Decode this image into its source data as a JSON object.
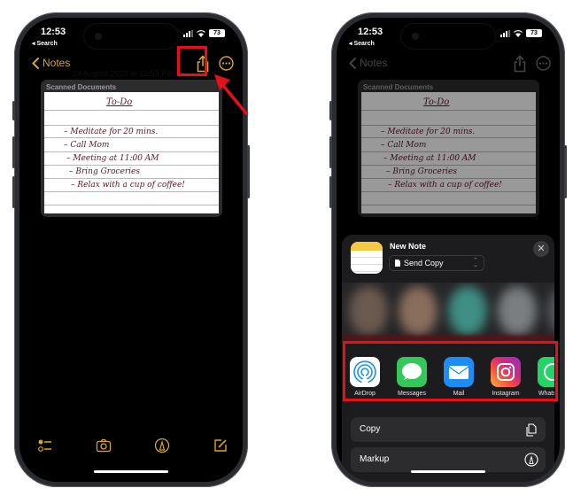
{
  "colors": {
    "accent": "#d9a52a",
    "highlight": "#e4101a",
    "screen_bg": "#000000",
    "sheet_bg": "#1c1c1e"
  },
  "left_phone": {
    "status": {
      "time": "12:53",
      "back_label": "◂ Search",
      "battery": "73"
    },
    "nav": {
      "back_label": "Notes",
      "back_icon": "chevron-left-icon",
      "share_icon": "share-icon",
      "more_icon": "ellipsis-circle-icon",
      "date": "24 August 2023 at 12:53 PM"
    },
    "document": {
      "section_title": "Scanned Documents",
      "handwriting_title": "To-Do",
      "handwriting_lines": [
        "– Meditate for 20 mins.",
        "– Call Mom",
        "– Meeting at 11:00 AM",
        "– Bring Groceries",
        "– Relax with a cup of coffee!"
      ]
    },
    "toolbar": [
      {
        "icon": "checklist-icon"
      },
      {
        "icon": "camera-icon"
      },
      {
        "icon": "markup-pen-icon"
      },
      {
        "icon": "compose-icon"
      }
    ]
  },
  "right_phone": {
    "status": {
      "time": "12:53",
      "back_label": "◂ Search",
      "battery": "73"
    },
    "nav": {
      "back_label": "Notes"
    },
    "document": {
      "section_title": "Scanned Documents",
      "handwriting_title": "To-Do",
      "handwriting_lines": [
        "– Meditate for 20 mins.",
        "– Call Mom",
        "– Meeting at 11:00 AM",
        "– Bring Groceries",
        "– Relax with a cup of coffee!"
      ]
    },
    "share_sheet": {
      "title": "New Note",
      "mode_selector": "Send Copy",
      "close_icon": "close-icon",
      "apps": [
        {
          "label": "AirDrop",
          "icon": "airdrop-icon",
          "color": "#ffffff"
        },
        {
          "label": "Messages",
          "icon": "messages-icon",
          "color": "#34c759"
        },
        {
          "label": "Mail",
          "icon": "mail-icon",
          "color": "#1e8cf5"
        },
        {
          "label": "Instagram",
          "icon": "instagram-icon",
          "color": "#d62976"
        },
        {
          "label": "WhatsApp",
          "icon": "whatsapp-icon",
          "color": "#25d366"
        }
      ],
      "actions": [
        {
          "label": "Copy",
          "icon": "copy-icon"
        },
        {
          "label": "Markup",
          "icon": "markup-pen-icon"
        }
      ]
    }
  }
}
